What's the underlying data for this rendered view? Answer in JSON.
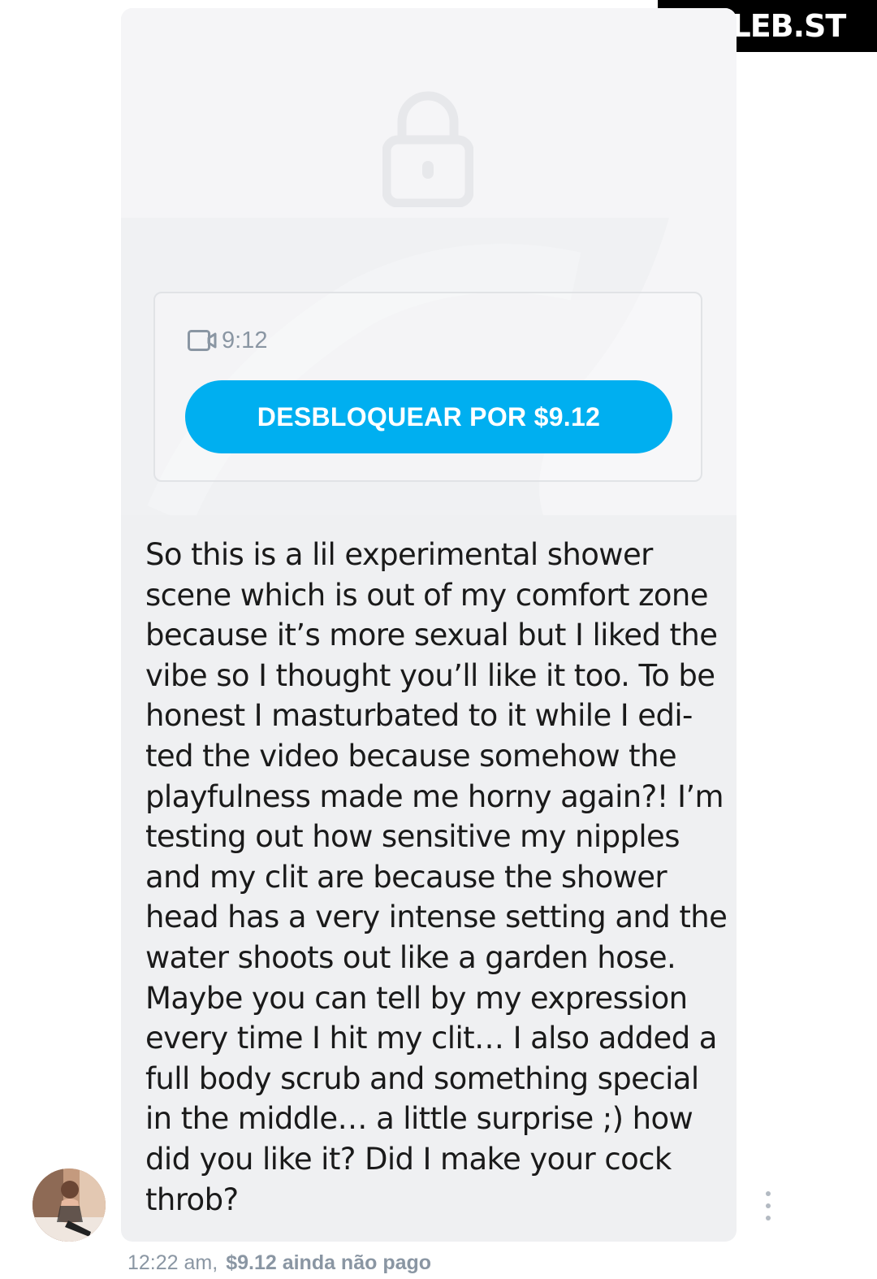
{
  "watermark": {
    "text": "CELEB.ST"
  },
  "post": {
    "media": {
      "duration": "9:12",
      "unlock_label": "DESBLOQUEAR POR $9.12",
      "accent_color": "#00aff0",
      "icons": [
        "lock-icon",
        "video-camera-icon"
      ]
    },
    "text": "So this is a lil experimental shower scene which is out of my comfort zone because it’s more sexual but I liked the vibe so I thought you’ll like it too. To be honest I masturbated to it while I edi-ted the video because somehow the playfulness made me horny again?! I’m testing out how sensitive my nipples and my clit are because the shower head has a very intense setting and the water shoots out like a garden hose. Maybe you can tell by my expression every time I hit my clit… I also added a full body scrub and something special in the middle… a little surprise ;) how did you like it? Did I make your cock throb?",
    "lines": [
      "So this is a lil experimental shower",
      "scene which is out of my comfort zone",
      "because it’s more sexual but I liked the",
      "vibe so I thought you’ll like it too. To be",
      "honest I masturbated to it while I edi-",
      "ted the video because somehow the",
      "playfulness made me horny again?! I’m",
      "testing out how sensitive my nipples",
      "and my clit are because the shower",
      "head has a very intense setting and the",
      "water shoots out like a garden hose.",
      "Maybe you can tell by my expression",
      "every time I hit my clit… I also added a",
      "full body scrub and something special",
      "in the middle… a little surprise ;) how",
      "did you like it? Did I make your cock",
      "throb?"
    ],
    "timestamp": "12:22 am,",
    "price_status": "$9.12 ainda não pago"
  }
}
